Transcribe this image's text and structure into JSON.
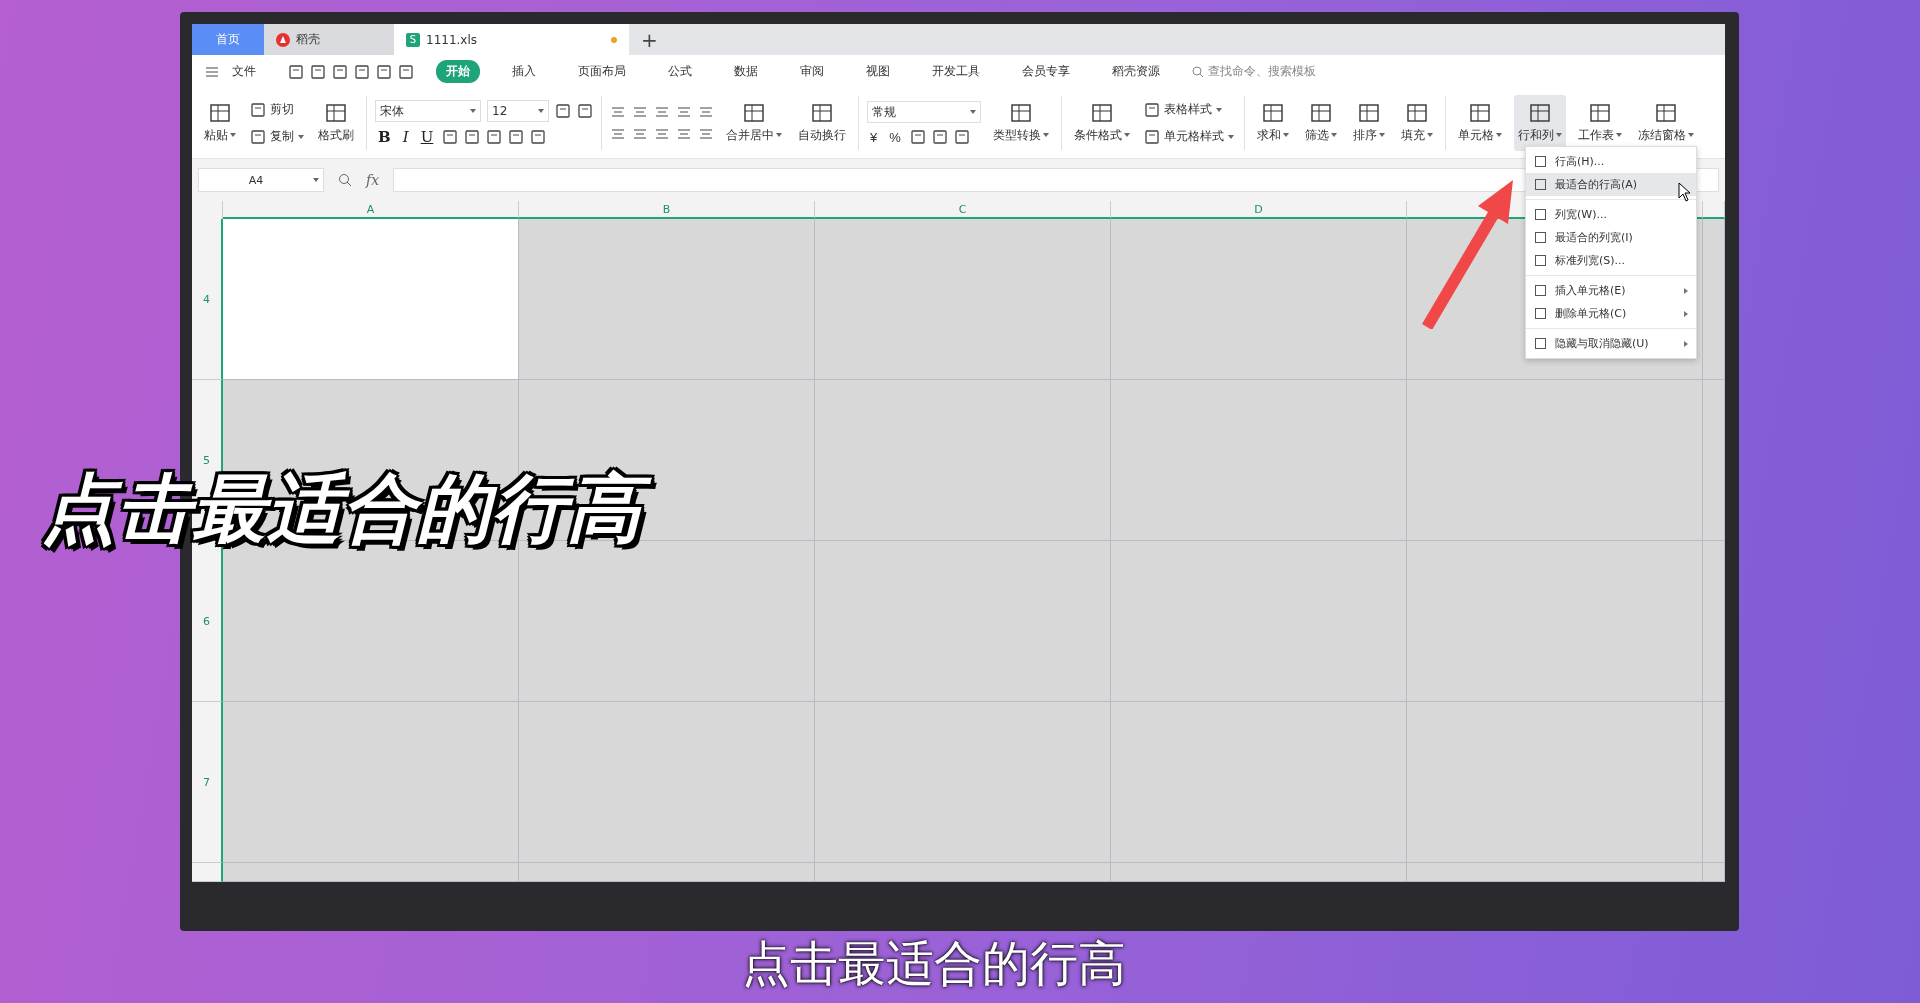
{
  "tabs": [
    {
      "label": "首页",
      "kind": "home",
      "selected": false,
      "modified": false
    },
    {
      "label": "稻壳",
      "kind": "docer",
      "selected": false,
      "modified": false
    },
    {
      "label": "1111.xls",
      "kind": "sheet",
      "icon_text": "S",
      "selected": true,
      "modified": true
    }
  ],
  "new_tab": "+",
  "menu_bar": {
    "file": "文件",
    "items": [
      {
        "label": "开始",
        "selected": true
      },
      {
        "label": "插入",
        "selected": false
      },
      {
        "label": "页面布局",
        "selected": false
      },
      {
        "label": "公式",
        "selected": false
      },
      {
        "label": "数据",
        "selected": false
      },
      {
        "label": "审阅",
        "selected": false
      },
      {
        "label": "视图",
        "selected": false
      },
      {
        "label": "开发工具",
        "selected": false
      },
      {
        "label": "会员专享",
        "selected": false
      },
      {
        "label": "稻壳资源",
        "selected": false
      }
    ],
    "search_placeholder": "查找命令、搜索模板"
  },
  "ribbon": [
    {
      "kind": "large",
      "label": "粘贴",
      "dropdown": true,
      "active": false
    },
    {
      "kind": "stack",
      "items": [
        {
          "label": "剪切",
          "dropdown": false
        },
        {
          "label": "复制",
          "dropdown": true
        }
      ]
    },
    {
      "kind": "large",
      "label": "格式刷",
      "dropdown": false,
      "active": false
    },
    {
      "kind": "divider"
    },
    {
      "kind": "font",
      "font_name": "宋体",
      "font_size": "12",
      "styles": [
        "B",
        "I",
        "U"
      ]
    },
    {
      "kind": "divider"
    },
    {
      "kind": "align"
    },
    {
      "kind": "large",
      "label": "合并居中",
      "dropdown": true,
      "active": false
    },
    {
      "kind": "large",
      "label": "自动换行",
      "dropdown": false,
      "active": false
    },
    {
      "kind": "divider"
    },
    {
      "kind": "number",
      "format": "常规",
      "symbols": [
        "¥",
        "%"
      ]
    },
    {
      "kind": "large",
      "label": "类型转换",
      "dropdown": true,
      "active": false
    },
    {
      "kind": "divider"
    },
    {
      "kind": "large",
      "label": "条件格式",
      "dropdown": true,
      "active": false
    },
    {
      "kind": "stack",
      "items": [
        {
          "label": "表格样式",
          "dropdown": true
        },
        {
          "label": "单元格样式",
          "dropdown": true
        }
      ]
    },
    {
      "kind": "divider"
    },
    {
      "kind": "large",
      "label": "求和",
      "dropdown": true,
      "active": false
    },
    {
      "kind": "large",
      "label": "筛选",
      "dropdown": true,
      "active": false
    },
    {
      "kind": "large",
      "label": "排序",
      "dropdown": true,
      "active": false
    },
    {
      "kind": "large",
      "label": "填充",
      "dropdown": true,
      "active": false
    },
    {
      "kind": "divider"
    },
    {
      "kind": "large",
      "label": "单元格",
      "dropdown": true,
      "active": false
    },
    {
      "kind": "large",
      "label": "行和列",
      "dropdown": true,
      "active": true
    },
    {
      "kind": "large",
      "label": "工作表",
      "dropdown": true,
      "active": false
    },
    {
      "kind": "large",
      "label": "冻结窗格",
      "dropdown": true,
      "active": false
    }
  ],
  "formula_bar": {
    "name_box": "A4",
    "fx": "fx"
  },
  "sheet": {
    "columns": [
      "A",
      "B",
      "C",
      "D"
    ],
    "rows": [
      {
        "label": "4",
        "cells": [
          {
            "selected": true
          },
          {
            "selected": false
          },
          {
            "selected": false
          },
          {
            "selected": false
          },
          {
            "selected": false
          }
        ]
      },
      {
        "label": "5",
        "cells": [
          {
            "selected": false
          },
          {
            "selected": false
          },
          {
            "selected": false
          },
          {
            "selected": false
          },
          {
            "selected": false
          }
        ]
      },
      {
        "label": "6",
        "cells": [
          {
            "selected": false
          },
          {
            "selected": false
          },
          {
            "selected": false
          },
          {
            "selected": false
          },
          {
            "selected": false
          }
        ]
      },
      {
        "label": "7",
        "cells": [
          {
            "selected": false
          },
          {
            "selected": false
          },
          {
            "selected": false
          },
          {
            "selected": false
          },
          {
            "selected": false
          }
        ]
      }
    ]
  },
  "context_menu": {
    "groups": [
      [
        {
          "label": "行高(H)...",
          "submenu": false,
          "selected": false
        },
        {
          "label": "最适合的行高(A)",
          "submenu": false,
          "selected": true
        }
      ],
      [
        {
          "label": "列宽(W)...",
          "submenu": false,
          "selected": false
        },
        {
          "label": "最适合的列宽(I)",
          "submenu": false,
          "selected": false
        },
        {
          "label": "标准列宽(S)...",
          "submenu": false,
          "selected": false
        }
      ],
      [
        {
          "label": "插入单元格(E)",
          "submenu": true,
          "selected": false
        },
        {
          "label": "删除单元格(C)",
          "submenu": true,
          "selected": false
        }
      ],
      [
        {
          "label": "隐藏与取消隐藏(U)",
          "submenu": true,
          "selected": false
        }
      ]
    ]
  },
  "caption": "点击最适合的行高",
  "subtitle": "点击最适合的行高"
}
